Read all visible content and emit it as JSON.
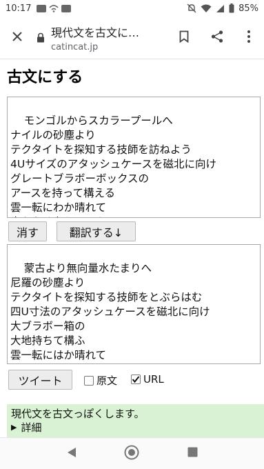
{
  "status_bar": {
    "time": "10:17",
    "battery_text": "85%",
    "icons": [
      "app-notification-icon",
      "wifi-calling-icon",
      "nfc-icon",
      "mute-icon",
      "wifi-icon",
      "signal-icon",
      "battery-icon"
    ]
  },
  "browser": {
    "page_title": "現代文を古文に…",
    "domain": "catincat.jp",
    "icons": {
      "close": "close-icon",
      "lock": "lock-icon",
      "bookmark": "bookmark-icon",
      "share": "share-icon",
      "menu": "more-vert-icon"
    }
  },
  "page": {
    "heading": "古文にする",
    "input_text": "モンゴルからスカラープールへ\nナイルの砂塵より\nテクタイトを探知する技師を訪ねよう\n4Uサイズのアタッシュケースを磁北に向け\nグレートブラボーボックスの\nアースを持って構える\n雲一転にわか晴れて\n音もなく奮うのは心",
    "clear_button": "消す",
    "translate_button": "翻訳する↓",
    "output_text": "蒙古より無向量水たまりへ\n尼羅の砂塵より\nテクタイトを探知する技師をとぶらはむ\n四U寸法のアタッシュケースを磁北に向け\n大ブラボー箱の\n大地持ちて構ふ\n雲一転にはか晴れて\n音もなく奮ふは心",
    "tweet_button": "ツイート",
    "checkbox_original": {
      "label": "原文",
      "checked": false
    },
    "checkbox_url": {
      "label": "URL",
      "checked": true
    },
    "info_text": "現代文を古文っぽくします。",
    "details_label": "詳細"
  },
  "colors": {
    "info_background": "#d9f2d4",
    "button_background": "#ececec"
  }
}
